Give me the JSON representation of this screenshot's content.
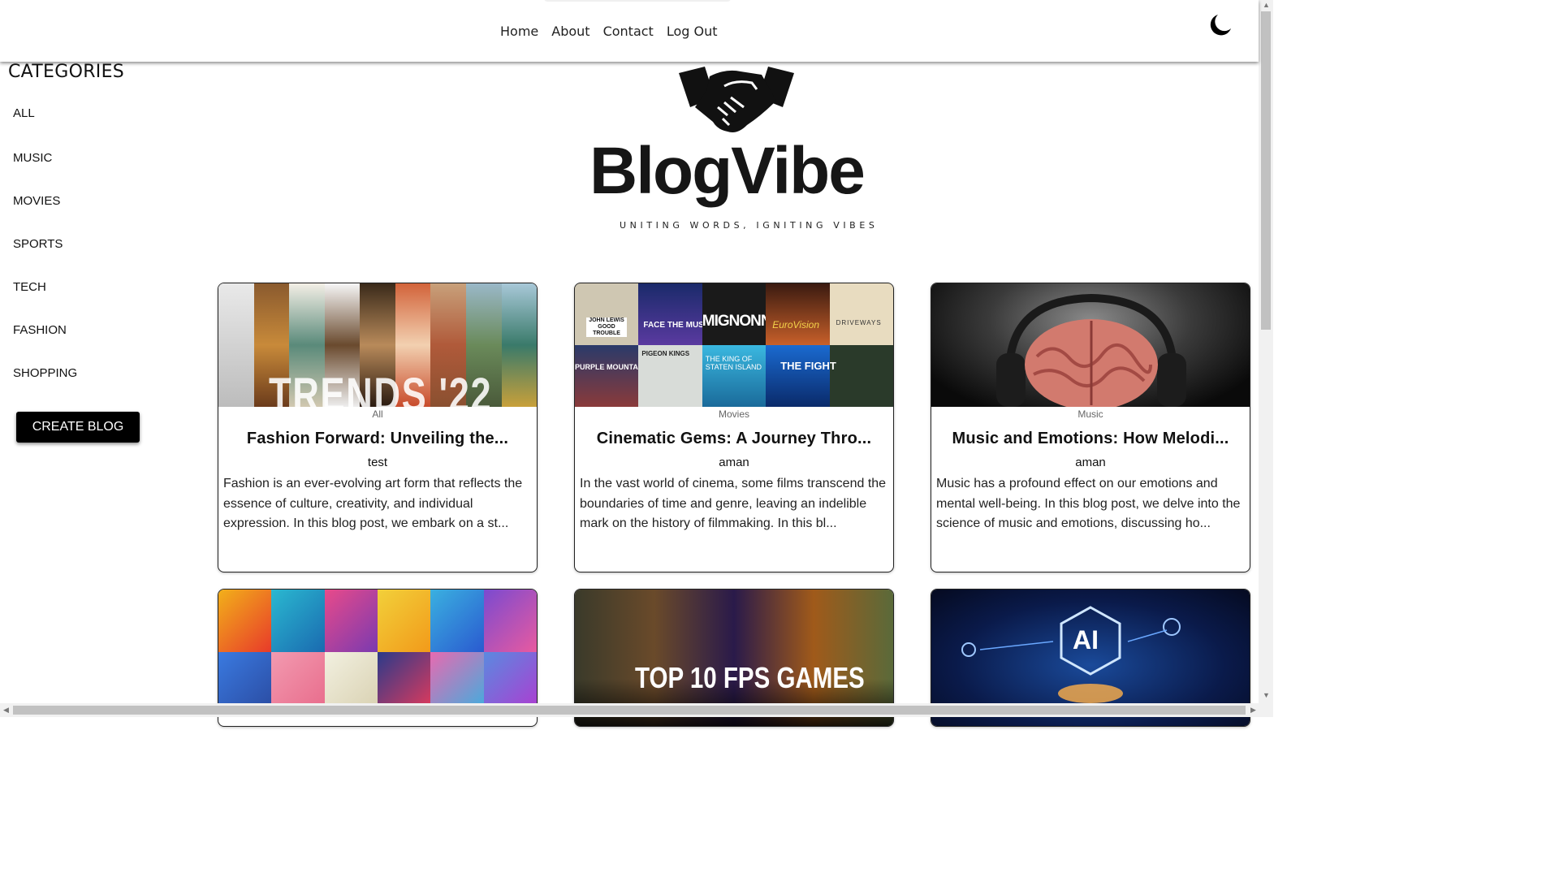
{
  "nav": {
    "links": [
      "Home",
      "About",
      "Contact",
      "Log Out"
    ],
    "theme_toggle_icon": "moon-icon"
  },
  "sidebar": {
    "title": "CATEGORIES",
    "items": [
      "ALL",
      "MUSIC",
      "MOVIES",
      "SPORTS",
      "TECH",
      "FASHION",
      "SHOPPING"
    ],
    "create_label": "CREATE BLOG"
  },
  "logo": {
    "icon": "handshake-icon",
    "name": "BlogVibe",
    "tagline": "UNITING WORDS, IGNITING VIBES"
  },
  "posts": [
    {
      "category": "All",
      "title": "Fashion Forward: Unveiling the...",
      "author": "test",
      "excerpt": "Fashion is an ever-evolving art form that reflects the essence of culture, creativity, and individual expression. In this blog post, we embark on a st...",
      "image_text": "TRENDS '22"
    },
    {
      "category": "Movies",
      "title": "Cinematic Gems: A Journey Thro...",
      "author": "aman",
      "excerpt": "In the vast world of cinema, some films transcend the boundaries of time and genre, leaving an indelible mark on the history of filmmaking. In this bl...",
      "image_texts": [
        "JOHN LEWIS GOOD TROUBLE",
        "FACE THE MUSIC",
        "MIGNONNE",
        "EuroVision",
        "DRIVEWAYS",
        "PURPLE MOUNTAINS",
        "PIGEON KINGS",
        "THE KING OF STATEN ISLAND",
        "THE FIGHT"
      ]
    },
    {
      "category": "Music",
      "title": "Music and Emotions: How Melodi...",
      "author": "aman",
      "excerpt": "Music has a profound effect on our emotions and mental well-being. In this blog post, we delve into the science of music and emotions, discussing ho..."
    },
    {
      "image": "sports-collage"
    },
    {
      "image_text": "TOP 10 FPS GAMES"
    },
    {
      "image_text": "AI"
    }
  ]
}
